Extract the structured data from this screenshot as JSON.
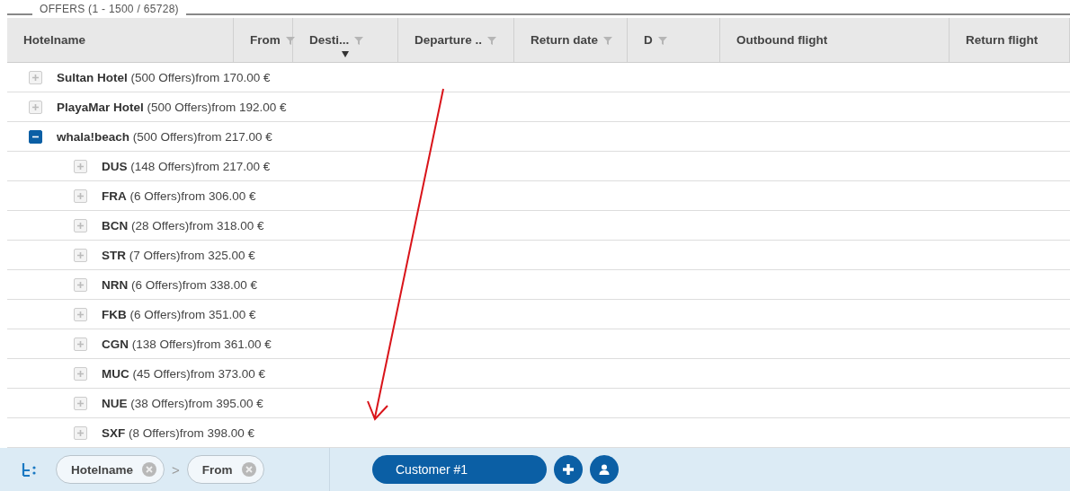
{
  "panel": {
    "title": "OFFERS (1 - 1500 / 65728)"
  },
  "table": {
    "columns": [
      {
        "label": "Hotelname",
        "filter": false,
        "sorted": false
      },
      {
        "label": "From",
        "filter": true,
        "sorted": false
      },
      {
        "label": "Desti...",
        "filter": true,
        "sorted": true
      },
      {
        "label": "Departure ..",
        "filter": true,
        "sorted": false
      },
      {
        "label": "Return date",
        "filter": true,
        "sorted": false
      },
      {
        "label": "D",
        "filter": true,
        "sorted": false
      },
      {
        "label": "Outbound flight",
        "filter": false,
        "sorted": false
      },
      {
        "label": "Return flight",
        "filter": false,
        "sorted": false
      }
    ],
    "rows": [
      {
        "text": "**Sultan Hotel** (500 Offers)from 170.00 €",
        "expanded": false
      },
      {
        "text": "**PlayaMar Hotel** (500 Offers)from 192.00 €",
        "expanded": false
      },
      {
        "text": "**whala!beach** (500 Offers)from 217.00 €",
        "expanded": true,
        "children": [
          {
            "text": "**DUS** (148 Offers)from 217.00 €",
            "expanded": false
          },
          {
            "text": "**FRA** (6 Offers)from 306.00 €",
            "expanded": false
          },
          {
            "text": "**BCN** (28 Offers)from 318.00 €",
            "expanded": false
          },
          {
            "text": "**STR** (7 Offers)from 325.00 €",
            "expanded": false
          },
          {
            "text": "**NRN** (6 Offers)from 338.00 €",
            "expanded": false
          },
          {
            "text": "**FKB** (6 Offers)from 351.00 €",
            "expanded": false
          },
          {
            "text": "**CGN** (138 Offers)from 361.00 €",
            "expanded": false
          },
          {
            "text": "**MUC** (45 Offers)from 373.00 €",
            "expanded": false
          },
          {
            "text": "**NUE** (38 Offers)from 395.00 €",
            "expanded": false
          },
          {
            "text": "**SXF** (8 Offers)from 398.00 €",
            "expanded": false
          }
        ]
      }
    ]
  },
  "grouping": {
    "chips": [
      {
        "label": "Hotelname"
      },
      {
        "label": "From"
      }
    ],
    "separator": ">"
  },
  "customer": {
    "label": "Customer #1"
  }
}
